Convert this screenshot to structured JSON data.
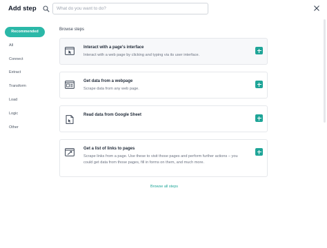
{
  "header": {
    "title": "Add step",
    "search_placeholder": "What do you want to do?",
    "search_value": ""
  },
  "categories": [
    {
      "label": "Recommended",
      "active": true
    },
    {
      "label": "All"
    },
    {
      "label": "Connect"
    },
    {
      "label": "Extract"
    },
    {
      "label": "Transform"
    },
    {
      "label": "Load"
    },
    {
      "label": "Logic"
    },
    {
      "label": "Other"
    }
  ],
  "section_label": "Browse steps",
  "steps": [
    {
      "title": "Interact with a page's interface",
      "description": "Interact with a web page by clicking and typing via its user interface.",
      "icon": "browser-interact-icon"
    },
    {
      "title": "Get data from a webpage",
      "description": "Scrape data from any web page.",
      "icon": "webpage-data-icon"
    },
    {
      "title": "Read data from Google Sheet",
      "description": "",
      "icon": "sheet-icon"
    },
    {
      "title": "Get a list of links to pages",
      "description": "Scrape links from a page. Use these to visit those pages and perform further actions – you could get data from those pages, fill in forms on them, and much more.",
      "icon": "links-list-icon"
    }
  ],
  "browse_all_label": "Browse all steps",
  "colors": {
    "accent": "#2bb8a8",
    "button": "#1fa598"
  }
}
